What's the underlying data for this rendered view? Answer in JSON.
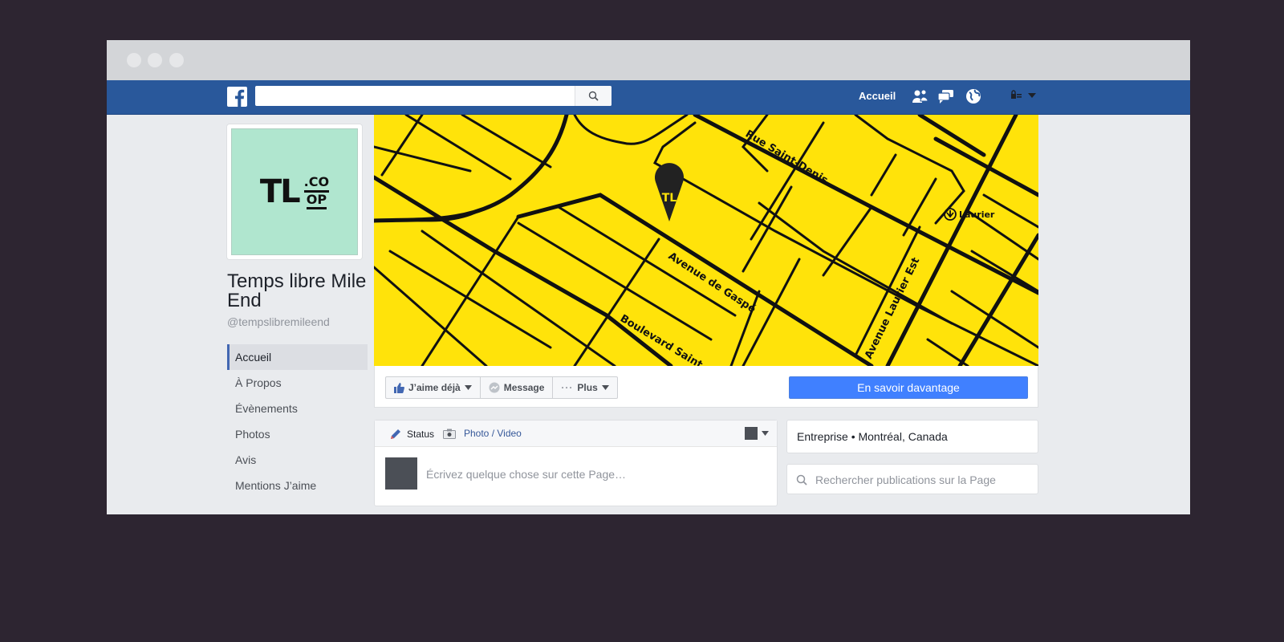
{
  "nav": {
    "home_label": "Accueil",
    "search_placeholder": ""
  },
  "profile": {
    "logo_text": "TL",
    "logo_text_top": ".CO",
    "logo_text_bottom": "OP",
    "name": "Temps libre Mile End",
    "handle": "@tempslibremileend"
  },
  "menu": {
    "items": [
      {
        "label": "Accueil",
        "active": true
      },
      {
        "label": "À Propos",
        "active": false
      },
      {
        "label": "Évènements",
        "active": false
      },
      {
        "label": "Photos",
        "active": false
      },
      {
        "label": "Avis",
        "active": false
      },
      {
        "label": "Mentions J’aime",
        "active": false
      }
    ]
  },
  "cover": {
    "marker_text": "TL",
    "streets": [
      "Rue Saint-Denis",
      "Avenue de Gaspé",
      "Boulevard Saint",
      "Avenue Laurier Est"
    ],
    "metro_label": "Laurier",
    "bg_color": "#ffe30a"
  },
  "actions": {
    "like_label": "J’aime déjà",
    "message_label": "Message",
    "more_label": "Plus",
    "cta_label": "En savoir davantage"
  },
  "composer": {
    "status_label": "Status",
    "photo_label": "Photo / Video",
    "placeholder": "Écrivez quelque chose sur cette Page…"
  },
  "info": {
    "category": "Entreprise • Montréal, Canada",
    "search_placeholder": "Rechercher publications sur la Page"
  },
  "colors": {
    "navbar": "#29589b",
    "accent": "#4080ff",
    "background": "#2d2531",
    "profile_bg": "#b0e6cf"
  }
}
